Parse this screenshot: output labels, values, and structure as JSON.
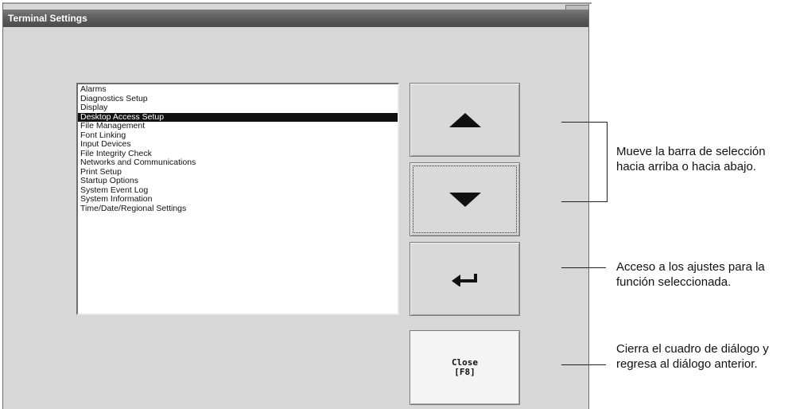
{
  "window": {
    "title": "Terminal Settings"
  },
  "list": {
    "selected_index": 3,
    "items": [
      "Alarms",
      "Diagnostics Setup",
      "Display",
      "Desktop Access Setup",
      "File Management",
      "Font Linking",
      "Input Devices",
      "File Integrity Check",
      "Networks and Communications",
      "Print Setup",
      "Startup Options",
      "System Event Log",
      "System Information",
      "Time/Date/Regional Settings"
    ]
  },
  "buttons": {
    "up_icon": "triangle-up-icon",
    "down_icon": "triangle-down-icon",
    "enter_icon": "enter-arrow-icon",
    "close_label_line1": "Close",
    "close_label_line2": "[F8]"
  },
  "annotations": {
    "move_line1": "Mueve la barra de selección",
    "move_line2": "hacia arriba o hacia abajo.",
    "access_line1": "Acceso a los ajustes para la",
    "access_line2": "función seleccionada.",
    "close_line1": "Cierra el cuadro de diálogo y",
    "close_line2": "regresa al diálogo anterior."
  }
}
